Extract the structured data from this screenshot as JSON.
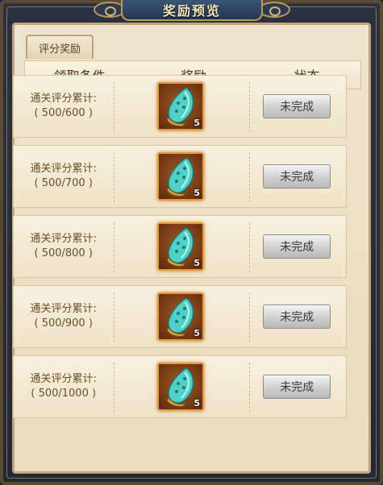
{
  "window": {
    "title": "奖励预览"
  },
  "tab": {
    "label": "评分奖励"
  },
  "header": {
    "condition": "领取条件",
    "reward": "奖励",
    "status": "状态"
  },
  "rows": [
    {
      "condition_line1": "通关评分累计:",
      "condition_line2": "( 500/600 )",
      "reward_icon": "jade-leaf-icon",
      "reward_count": "5",
      "status_label": "未完成"
    },
    {
      "condition_line1": "通关评分累计:",
      "condition_line2": "( 500/700 )",
      "reward_icon": "jade-leaf-icon",
      "reward_count": "5",
      "status_label": "未完成"
    },
    {
      "condition_line1": "通关评分累计:",
      "condition_line2": "( 500/800 )",
      "reward_icon": "jade-leaf-icon",
      "reward_count": "5",
      "status_label": "未完成"
    },
    {
      "condition_line1": "通关评分累计:",
      "condition_line2": "( 500/900 )",
      "reward_icon": "jade-leaf-icon",
      "reward_count": "5",
      "status_label": "未完成"
    },
    {
      "condition_line1": "通关评分累计:",
      "condition_line2": "( 500/1000 )",
      "reward_icon": "jade-leaf-icon",
      "reward_count": "5",
      "status_label": "未完成"
    }
  ],
  "colors": {
    "panel": "#efe4cc",
    "item_border": "#e39a3c",
    "button": "#d2d2d2",
    "title_text": "#f3e3b8"
  }
}
